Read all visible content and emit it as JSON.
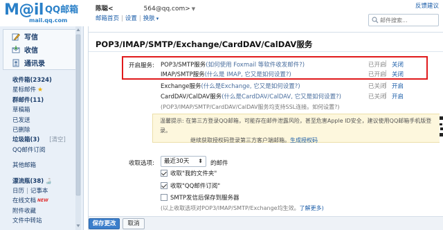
{
  "header": {
    "logo_text": "M@il",
    "logo_qq": "QQ邮箱",
    "logo_domain": "mail.qq.com",
    "user_name": "陈聪<",
    "user_email_tail": "564@qq.com>",
    "links": [
      "邮箱首页",
      "设置",
      "换肤"
    ],
    "separator": "|",
    "feedback": "反馈建议",
    "search_placeholder": "邮件搜索..."
  },
  "sidebar": {
    "compose": "写信",
    "inbox_btn": "收信",
    "contacts": "通讯录",
    "folders": [
      {
        "label": "收件箱",
        "count": "(2324)"
      },
      {
        "label": "星标邮件"
      },
      {
        "label": "群邮件",
        "count": "(11)"
      },
      {
        "label": "草稿箱"
      },
      {
        "label": "已发送"
      },
      {
        "label": "已删除"
      },
      {
        "label": "垃圾箱",
        "count": "(3)",
        "extra": "[清空]"
      },
      {
        "label": "QQ邮件订阅"
      },
      {
        "label": "其他邮箱"
      },
      {
        "label": "漂流瓶",
        "count": "(38)"
      },
      {
        "label": "日历",
        "extra": "记事本"
      },
      {
        "label": "在线文档",
        "badge": "NEW"
      },
      {
        "label": "附件收藏"
      },
      {
        "label": "文件中转站"
      }
    ],
    "separator": "|"
  },
  "main": {
    "title": "POP3/IMAP/SMTP/Exchange/CardDAV/CalDAV服务",
    "service_label": "开启服务:",
    "services": [
      {
        "name": "POP3/SMTP服务",
        "hint": "(如何使用 Foxmail 等软件收发邮件?)",
        "state": "已开启",
        "action": "关闭"
      },
      {
        "name": "IMAP/SMTP服务",
        "hint": "(什么是 IMAP, 它又是如何设置?)",
        "state": "已开启",
        "action": "关闭"
      },
      {
        "name": "Exchange服务",
        "hint": "(什么是Exchange, 它又是如何设置?)",
        "state": "已关闭",
        "action": "开启"
      },
      {
        "name": "CardDAV/CalDAV服务",
        "hint": "(什么是CardDAV/CalDAV, 它又是如何设置?)",
        "state": "已关闭",
        "action": "开启"
      }
    ],
    "services_note": "(POP3/IMAP/SMTP/CardDAV/CalDAV服务均支持SSL连接。如何设置?)",
    "tip_label": "温馨提示:",
    "tip_line1": "在第三方登录QQ邮箱，可能存在邮件泄露风险，甚至危害Apple ID安全，建议使用QQ邮箱手机版登录。",
    "tip_line2": "继续获取授权码登录第三方客户端邮箱",
    "tip_link": "生成授权码",
    "receive_label": "收取选项:",
    "receive_select": "最近30天",
    "receive_suffix": "的邮件",
    "options": [
      {
        "label": "收取\"我的文件夹\"",
        "checked": true
      },
      {
        "label": "收取\"QQ邮件订阅\"",
        "checked": true
      },
      {
        "label": "SMTP发信后保存到服务器",
        "checked": false
      }
    ],
    "options_note": "(以上收取选项对POP3/IMAP/SMTP/Exchange均生效。",
    "options_link": "了解更多)",
    "save_button": "保存更改",
    "cancel_button": "取消"
  }
}
